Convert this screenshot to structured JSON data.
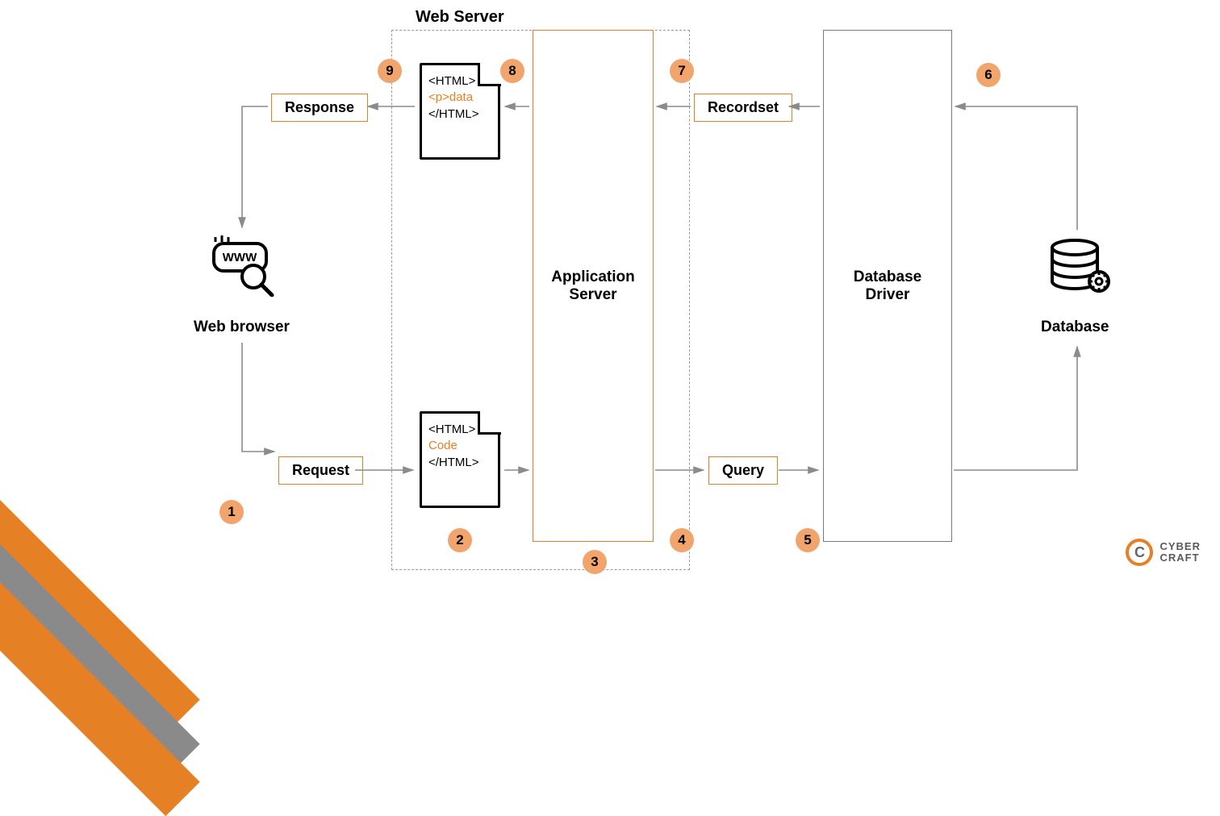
{
  "title": "Web Server",
  "nodes": {
    "web_browser": "Web browser",
    "app_server": "Application\nServer",
    "db_driver": "Database\nDriver",
    "database": "Database"
  },
  "boxes": {
    "request": "Request",
    "response": "Response",
    "query": "Query",
    "recordset": "Recordset"
  },
  "docs": {
    "bottom": {
      "l1": "<HTML>",
      "l2": "Code",
      "l3": "</HTML>"
    },
    "top": {
      "l1": "<HTML>",
      "l2": "<p>data",
      "l3": "</HTML>"
    }
  },
  "badges": {
    "b1": "1",
    "b2": "2",
    "b3": "3",
    "b4": "4",
    "b5": "5",
    "b6": "6",
    "b7": "7",
    "b8": "8",
    "b9": "9"
  },
  "logo": {
    "letter": "C",
    "line1": "CYBER",
    "line2": "CRAFT"
  }
}
